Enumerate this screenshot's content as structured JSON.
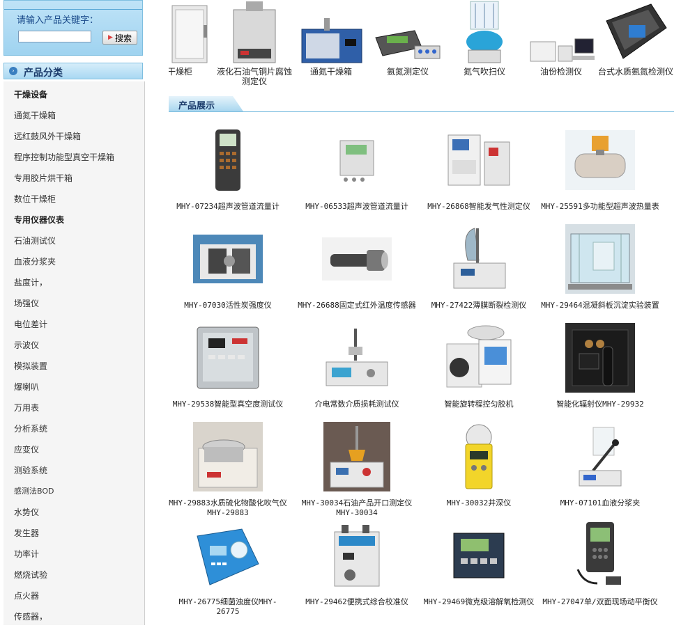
{
  "search": {
    "label": "请输入产品关键字：",
    "input_value": "",
    "button_label": "搜索"
  },
  "category": {
    "title": "产品分类",
    "items": [
      {
        "label": "干燥设备",
        "head": true
      },
      {
        "label": "通氮干燥箱"
      },
      {
        "label": "远红鼓风外干燥箱"
      },
      {
        "label": "程序控制功能型真空干燥箱"
      },
      {
        "label": "专用胶片烘干箱"
      },
      {
        "label": "数位干燥柜"
      },
      {
        "label": "专用仪器仪表",
        "head": true
      },
      {
        "label": "石油测试仪"
      },
      {
        "label": "血液分浆夹"
      },
      {
        "label": "盐度计，"
      },
      {
        "label": "场强仪"
      },
      {
        "label": "电位差计"
      },
      {
        "label": "示波仪"
      },
      {
        "label": "模拟装置"
      },
      {
        "label": "爆喇叭"
      },
      {
        "label": "万用表"
      },
      {
        "label": "分析系统"
      },
      {
        "label": "应变仪"
      },
      {
        "label": "测验系统"
      },
      {
        "label": "感测法BOD"
      },
      {
        "label": "水势仪"
      },
      {
        "label": "发生器"
      },
      {
        "label": "功率计"
      },
      {
        "label": "燃烧试验"
      },
      {
        "label": "点火器"
      },
      {
        "label": "传感器，"
      }
    ]
  },
  "top_products": [
    {
      "label": "位干燥柜"
    },
    {
      "label": "液化石油气铜片腐蚀测定仪"
    },
    {
      "label": "通氮干燥箱"
    },
    {
      "label": "氨氮测定仪"
    },
    {
      "label": "氮气吹扫仪"
    },
    {
      "label": "油份检测仪"
    },
    {
      "label": "台式水质氨氮检测仪"
    }
  ],
  "section": {
    "title": "产品展示"
  },
  "products": [
    {
      "label": "MHY-07234超声波管道流量计"
    },
    {
      "label": "MHY-06533超声波管道流量计"
    },
    {
      "label": "MHY-26868智能发气性测定仪"
    },
    {
      "label": "MHY-25591多功能型超声波热量表"
    },
    {
      "label": "MHY-07030活性炭强度仪"
    },
    {
      "label": "MHY-26688固定式红外温度传感器"
    },
    {
      "label": "MHY-27422薄膜断裂检测仪"
    },
    {
      "label": "MHY-29464混凝斜板沉淀实验装置"
    },
    {
      "label": "MHY-29538智能型真空度测试仪"
    },
    {
      "label": "介电常数介质损耗测试仪"
    },
    {
      "label": "智能旋转程控匀胶机"
    },
    {
      "label": "智能化辐射仪MHY-29932"
    },
    {
      "label": "MHY-29883水质硫化物酸化吹气仪MHY-29883"
    },
    {
      "label": "MHY-30034石油产品开口测定仪MHY-30034"
    },
    {
      "label": "MHY-30032井深仪"
    },
    {
      "label": "MHY-07101血液分浆夹"
    },
    {
      "label": "MHY-26775细菌浊度仪MHY-26775"
    },
    {
      "label": "MHY-29462便携式综合校准仪"
    },
    {
      "label": "MHY-29469微克级溶解氧检测仪"
    },
    {
      "label": "MHY-27047单/双面现场动平衡仪"
    }
  ]
}
